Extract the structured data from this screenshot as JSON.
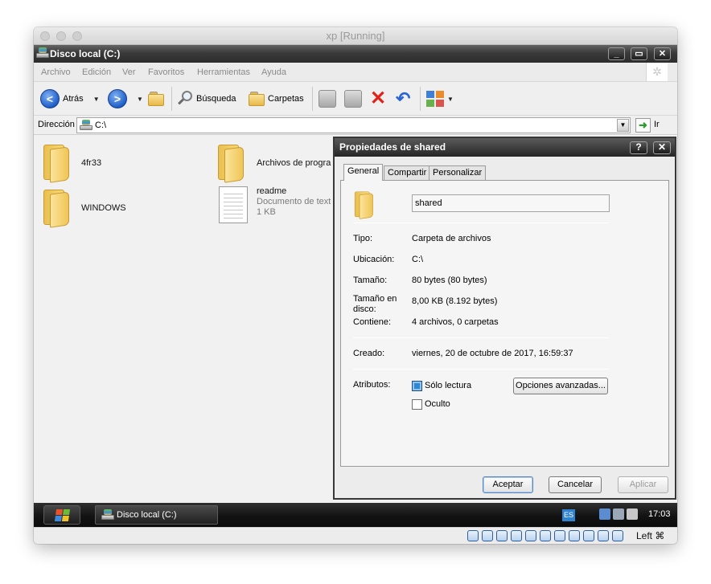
{
  "vbox": {
    "title": "xp [Running]",
    "host_key": "Left ⌘"
  },
  "window": {
    "title": "Disco local (C:)"
  },
  "menu": [
    "Archivo",
    "Edición",
    "Ver",
    "Favoritos",
    "Herramientas",
    "Ayuda"
  ],
  "toolbar": {
    "back": "Atrás",
    "search": "Búsqueda",
    "folders": "Carpetas"
  },
  "address": {
    "label": "Dirección",
    "value": "C:\\",
    "go": "Ir"
  },
  "files": [
    {
      "name": "4fr33",
      "type": "folder"
    },
    {
      "name": "Archivos de programa",
      "type": "folder"
    },
    {
      "name": "WINDOWS",
      "type": "folder"
    },
    {
      "name": "readme",
      "type": "document",
      "kind": "Documento de texto",
      "size": "1 KB"
    }
  ],
  "dialog": {
    "title": "Propiedades de shared",
    "help": "?",
    "close": "✕",
    "tabs": [
      "General",
      "Compartir",
      "Personalizar"
    ],
    "name": "shared",
    "props": [
      {
        "label": "Tipo:",
        "value": "Carpeta de archivos"
      },
      {
        "label": "Ubicación:",
        "value": "C:\\"
      },
      {
        "label": "Tamaño:",
        "value": "80 bytes (80 bytes)"
      },
      {
        "label": "Tamaño en disco:",
        "value": "8,00 KB (8.192 bytes)"
      },
      {
        "label": "Contiene:",
        "value": "4 archivos, 0 carpetas"
      }
    ],
    "created_label": "Creado:",
    "created_value": "viernes, 20 de octubre de 2017, 16:59:37",
    "attributes_label": "Atributos:",
    "readonly_label": "Sólo lectura",
    "readonly_checked": true,
    "hidden_label": "Oculto",
    "hidden_checked": false,
    "advanced_button": "Opciones avanzadas...",
    "ok": "Aceptar",
    "cancel": "Cancelar",
    "apply": "Aplicar"
  },
  "taskbar": {
    "item": "Disco local (C:)",
    "lang": "ES",
    "clock": "17:03"
  }
}
